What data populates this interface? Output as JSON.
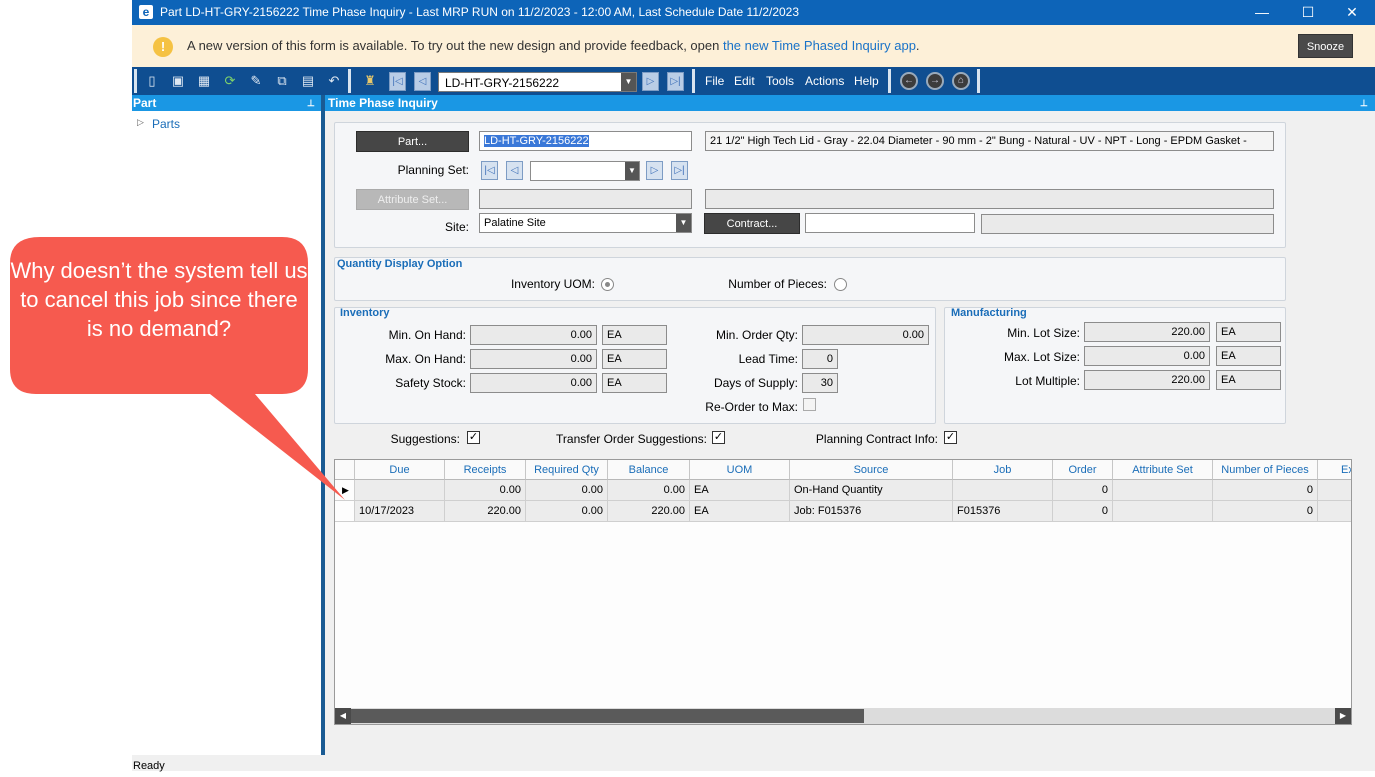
{
  "window": {
    "title": "Part LD-HT-GRY-2156222 Time Phase Inquiry  - Last MRP RUN on 11/2/2023 - 12:00 AM, Last Schedule Date  11/2/2023",
    "app_icon": "e",
    "controls": {
      "minimize": "—",
      "maximize": "☐",
      "close": "✕"
    }
  },
  "banner": {
    "message": "A new version of this form is available. To try out the new design and provide feedback, open ",
    "link": "the new Time Phased Inquiry app",
    "suffix": ".",
    "snooze": "Snooze"
  },
  "toolbar": {
    "part_value": "LD-HT-GRY-2156222",
    "menus": [
      "File",
      "Edit",
      "Tools",
      "Actions",
      "Help"
    ]
  },
  "left_panel": {
    "title": "Part",
    "tree_root": "Parts"
  },
  "main": {
    "title": "Time Phase Inquiry",
    "part_button": "Part...",
    "part_number": "LD-HT-GRY-2156222",
    "part_description": "21 1/2\" High Tech Lid - Gray - 22.04 Diameter - 90 mm - 2\" Bung - Natural - UV - NPT - Long - EPDM Gasket -",
    "planning_set_label": "Planning Set:",
    "attribute_set_button": "Attribute Set...",
    "site_label": "Site:",
    "site_value": "Palatine Site",
    "contract_button": "Contract..."
  },
  "qty_display": {
    "title": "Quantity Display Option",
    "inventory_uom_label": "Inventory UOM:",
    "pieces_label": "Number of Pieces:"
  },
  "inventory": {
    "title": "Inventory",
    "min_on_hand_label": "Min. On Hand:",
    "min_on_hand": "0.00",
    "min_on_hand_uom": "EA",
    "max_on_hand_label": "Max. On Hand:",
    "max_on_hand": "0.00",
    "max_on_hand_uom": "EA",
    "safety_stock_label": "Safety Stock:",
    "safety_stock": "0.00",
    "safety_stock_uom": "EA",
    "min_order_qty_label": "Min. Order Qty:",
    "min_order_qty": "0.00",
    "lead_time_label": "Lead Time:",
    "lead_time": "0",
    "days_supply_label": "Days of Supply:",
    "days_supply": "30",
    "reorder_max_label": "Re-Order to Max:"
  },
  "manufacturing": {
    "title": "Manufacturing",
    "min_lot_label": "Min. Lot Size:",
    "min_lot": "220.00",
    "min_lot_uom": "EA",
    "max_lot_label": "Max. Lot Size:",
    "max_lot": "0.00",
    "max_lot_uom": "EA",
    "lot_multiple_label": "Lot Multiple:",
    "lot_multiple": "220.00",
    "lot_multiple_uom": "EA"
  },
  "options": {
    "suggestions_label": "Suggestions:",
    "transfer_label": "Transfer Order Suggestions:",
    "contract_info_label": "Planning Contract Info:",
    "check": "✓"
  },
  "grid": {
    "columns": [
      "Due",
      "Receipts",
      "Required Qty",
      "Balance",
      "UOM",
      "Source",
      "Job",
      "Order",
      "Attribute Set",
      "Number of Pieces",
      "Ex"
    ],
    "rows": [
      [
        "",
        "0.00",
        "0.00",
        "0.00",
        "EA",
        "On-Hand Quantity",
        "",
        "0",
        "",
        "0",
        ""
      ],
      [
        "10/17/2023",
        "220.00",
        "0.00",
        "220.00",
        "EA",
        "Job: F015376",
        "F015376",
        "0",
        "",
        "0",
        ""
      ]
    ]
  },
  "status": {
    "text": "Ready"
  },
  "callout": {
    "text": "Why doesn’t the system tell us to cancel this job since there is no demand?",
    "color": "#f65a4f"
  }
}
